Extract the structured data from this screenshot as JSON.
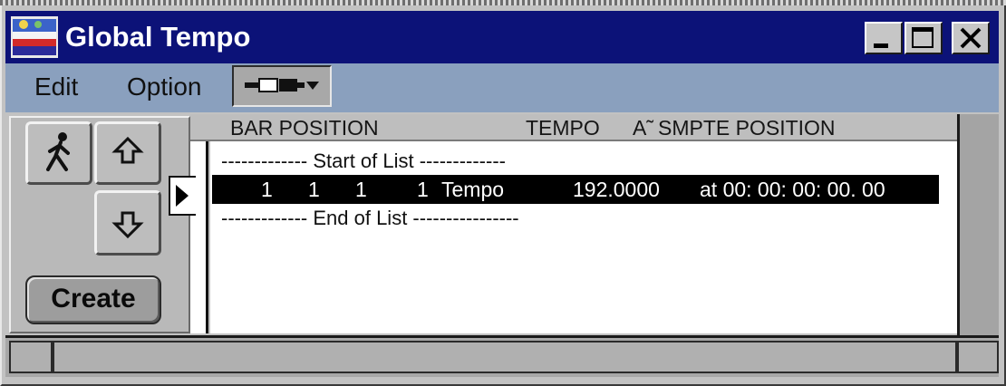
{
  "window": {
    "title": "Global Tempo",
    "controls": [
      "minimize-icon",
      "maximize-icon",
      "close-icon"
    ],
    "colors": {
      "titlebar": "#0c1278",
      "menubar": "#8aa0be",
      "selection": "#000000"
    }
  },
  "menu": {
    "items": [
      "Edit",
      "Option"
    ],
    "tool_icon": "cable-dropdown-icon"
  },
  "left_panel": {
    "walk_icon": "walking-figure-icon",
    "up_icon": "arrow-up-icon",
    "down_icon": "arrow-down-icon",
    "create_label": "Create"
  },
  "list": {
    "headers": {
      "bar_position": "BAR POSITION",
      "tempo": "TEMPO",
      "at": "A˜",
      "smpte": "SMPTE POSITION"
    },
    "start_marker": "------------- Start of List -------------",
    "end_marker": "------------- End of List ----------------",
    "rows": [
      {
        "bar": "1",
        "beat": "1",
        "tick": "1",
        "sub": "1",
        "type": "Tempo",
        "tempo": "192.0000",
        "smpte": "at 00: 00: 00: 00. 00"
      }
    ]
  }
}
